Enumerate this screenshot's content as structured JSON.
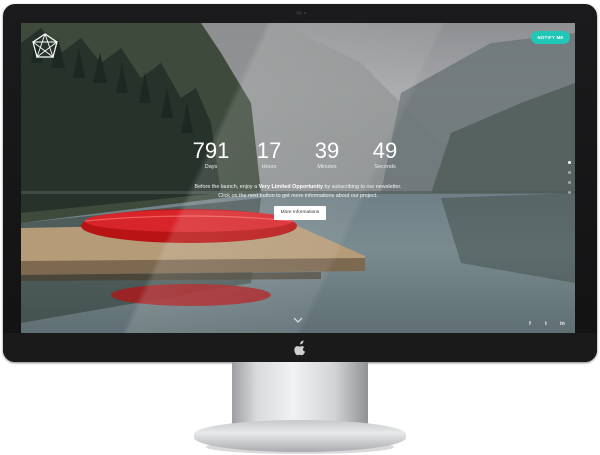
{
  "header": {
    "notify_label": "NOTIFY ME"
  },
  "countdown": [
    {
      "value": "791",
      "label": "Days"
    },
    {
      "value": "17",
      "label": "Hours"
    },
    {
      "value": "39",
      "label": "Minutes"
    },
    {
      "value": "49",
      "label": "Seconds"
    }
  ],
  "message": {
    "line1_before": "Before the launch, enjoy a ",
    "line1_strong": "Very Limited Opportunity",
    "line1_after": " by subscribing to our newsletter.",
    "line2": "Click on the next button to get more informations about our project."
  },
  "more_button_label": "More Informations",
  "social": {
    "facebook": "f",
    "twitter": "t",
    "linkedin": "in"
  },
  "slide_dots": {
    "count": 4,
    "active_index": 0
  },
  "icons": [
    "logo-icon",
    "apple-icon",
    "chevron-down-icon",
    "facebook-icon",
    "twitter-icon",
    "linkedin-icon"
  ],
  "colors": {
    "accent": "#20c6b6",
    "canoe": "#c8191a"
  }
}
